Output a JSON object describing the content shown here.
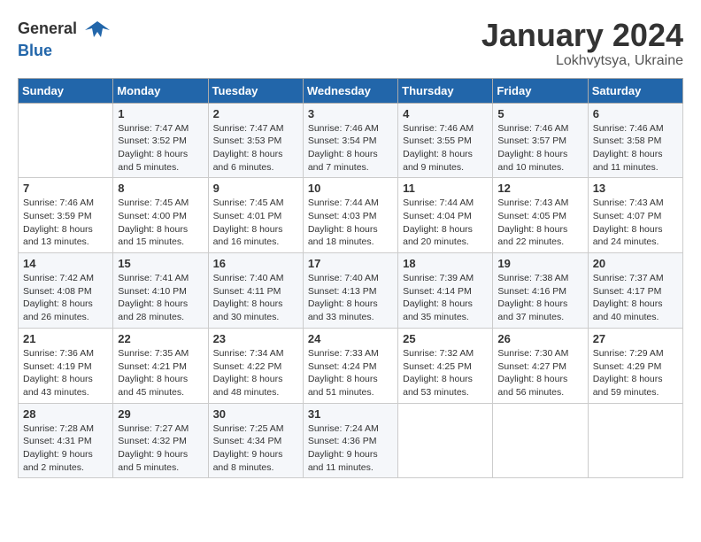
{
  "header": {
    "logo_general": "General",
    "logo_blue": "Blue",
    "month": "January 2024",
    "location": "Lokhvytsya, Ukraine"
  },
  "weekdays": [
    "Sunday",
    "Monday",
    "Tuesday",
    "Wednesday",
    "Thursday",
    "Friday",
    "Saturday"
  ],
  "weeks": [
    [
      {
        "day": "",
        "sunrise": "",
        "sunset": "",
        "daylight": ""
      },
      {
        "day": "1",
        "sunrise": "Sunrise: 7:47 AM",
        "sunset": "Sunset: 3:52 PM",
        "daylight": "Daylight: 8 hours and 5 minutes."
      },
      {
        "day": "2",
        "sunrise": "Sunrise: 7:47 AM",
        "sunset": "Sunset: 3:53 PM",
        "daylight": "Daylight: 8 hours and 6 minutes."
      },
      {
        "day": "3",
        "sunrise": "Sunrise: 7:46 AM",
        "sunset": "Sunset: 3:54 PM",
        "daylight": "Daylight: 8 hours and 7 minutes."
      },
      {
        "day": "4",
        "sunrise": "Sunrise: 7:46 AM",
        "sunset": "Sunset: 3:55 PM",
        "daylight": "Daylight: 8 hours and 9 minutes."
      },
      {
        "day": "5",
        "sunrise": "Sunrise: 7:46 AM",
        "sunset": "Sunset: 3:57 PM",
        "daylight": "Daylight: 8 hours and 10 minutes."
      },
      {
        "day": "6",
        "sunrise": "Sunrise: 7:46 AM",
        "sunset": "Sunset: 3:58 PM",
        "daylight": "Daylight: 8 hours and 11 minutes."
      }
    ],
    [
      {
        "day": "7",
        "sunrise": "Sunrise: 7:46 AM",
        "sunset": "Sunset: 3:59 PM",
        "daylight": "Daylight: 8 hours and 13 minutes."
      },
      {
        "day": "8",
        "sunrise": "Sunrise: 7:45 AM",
        "sunset": "Sunset: 4:00 PM",
        "daylight": "Daylight: 8 hours and 15 minutes."
      },
      {
        "day": "9",
        "sunrise": "Sunrise: 7:45 AM",
        "sunset": "Sunset: 4:01 PM",
        "daylight": "Daylight: 8 hours and 16 minutes."
      },
      {
        "day": "10",
        "sunrise": "Sunrise: 7:44 AM",
        "sunset": "Sunset: 4:03 PM",
        "daylight": "Daylight: 8 hours and 18 minutes."
      },
      {
        "day": "11",
        "sunrise": "Sunrise: 7:44 AM",
        "sunset": "Sunset: 4:04 PM",
        "daylight": "Daylight: 8 hours and 20 minutes."
      },
      {
        "day": "12",
        "sunrise": "Sunrise: 7:43 AM",
        "sunset": "Sunset: 4:05 PM",
        "daylight": "Daylight: 8 hours and 22 minutes."
      },
      {
        "day": "13",
        "sunrise": "Sunrise: 7:43 AM",
        "sunset": "Sunset: 4:07 PM",
        "daylight": "Daylight: 8 hours and 24 minutes."
      }
    ],
    [
      {
        "day": "14",
        "sunrise": "Sunrise: 7:42 AM",
        "sunset": "Sunset: 4:08 PM",
        "daylight": "Daylight: 8 hours and 26 minutes."
      },
      {
        "day": "15",
        "sunrise": "Sunrise: 7:41 AM",
        "sunset": "Sunset: 4:10 PM",
        "daylight": "Daylight: 8 hours and 28 minutes."
      },
      {
        "day": "16",
        "sunrise": "Sunrise: 7:40 AM",
        "sunset": "Sunset: 4:11 PM",
        "daylight": "Daylight: 8 hours and 30 minutes."
      },
      {
        "day": "17",
        "sunrise": "Sunrise: 7:40 AM",
        "sunset": "Sunset: 4:13 PM",
        "daylight": "Daylight: 8 hours and 33 minutes."
      },
      {
        "day": "18",
        "sunrise": "Sunrise: 7:39 AM",
        "sunset": "Sunset: 4:14 PM",
        "daylight": "Daylight: 8 hours and 35 minutes."
      },
      {
        "day": "19",
        "sunrise": "Sunrise: 7:38 AM",
        "sunset": "Sunset: 4:16 PM",
        "daylight": "Daylight: 8 hours and 37 minutes."
      },
      {
        "day": "20",
        "sunrise": "Sunrise: 7:37 AM",
        "sunset": "Sunset: 4:17 PM",
        "daylight": "Daylight: 8 hours and 40 minutes."
      }
    ],
    [
      {
        "day": "21",
        "sunrise": "Sunrise: 7:36 AM",
        "sunset": "Sunset: 4:19 PM",
        "daylight": "Daylight: 8 hours and 43 minutes."
      },
      {
        "day": "22",
        "sunrise": "Sunrise: 7:35 AM",
        "sunset": "Sunset: 4:21 PM",
        "daylight": "Daylight: 8 hours and 45 minutes."
      },
      {
        "day": "23",
        "sunrise": "Sunrise: 7:34 AM",
        "sunset": "Sunset: 4:22 PM",
        "daylight": "Daylight: 8 hours and 48 minutes."
      },
      {
        "day": "24",
        "sunrise": "Sunrise: 7:33 AM",
        "sunset": "Sunset: 4:24 PM",
        "daylight": "Daylight: 8 hours and 51 minutes."
      },
      {
        "day": "25",
        "sunrise": "Sunrise: 7:32 AM",
        "sunset": "Sunset: 4:25 PM",
        "daylight": "Daylight: 8 hours and 53 minutes."
      },
      {
        "day": "26",
        "sunrise": "Sunrise: 7:30 AM",
        "sunset": "Sunset: 4:27 PM",
        "daylight": "Daylight: 8 hours and 56 minutes."
      },
      {
        "day": "27",
        "sunrise": "Sunrise: 7:29 AM",
        "sunset": "Sunset: 4:29 PM",
        "daylight": "Daylight: 8 hours and 59 minutes."
      }
    ],
    [
      {
        "day": "28",
        "sunrise": "Sunrise: 7:28 AM",
        "sunset": "Sunset: 4:31 PM",
        "daylight": "Daylight: 9 hours and 2 minutes."
      },
      {
        "day": "29",
        "sunrise": "Sunrise: 7:27 AM",
        "sunset": "Sunset: 4:32 PM",
        "daylight": "Daylight: 9 hours and 5 minutes."
      },
      {
        "day": "30",
        "sunrise": "Sunrise: 7:25 AM",
        "sunset": "Sunset: 4:34 PM",
        "daylight": "Daylight: 9 hours and 8 minutes."
      },
      {
        "day": "31",
        "sunrise": "Sunrise: 7:24 AM",
        "sunset": "Sunset: 4:36 PM",
        "daylight": "Daylight: 9 hours and 11 minutes."
      },
      {
        "day": "",
        "sunrise": "",
        "sunset": "",
        "daylight": ""
      },
      {
        "day": "",
        "sunrise": "",
        "sunset": "",
        "daylight": ""
      },
      {
        "day": "",
        "sunrise": "",
        "sunset": "",
        "daylight": ""
      }
    ]
  ]
}
